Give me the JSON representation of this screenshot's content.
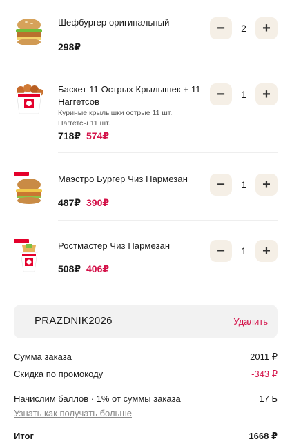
{
  "items": [
    {
      "title": "Шефбургер оригинальный",
      "price": "298₽",
      "qty": "2",
      "image": "chef-burger-image"
    },
    {
      "title": "Баскет 11 Острых Крылышек + 11 Наггетсов",
      "sub": [
        "Куриные крылышки острые 11 шт.",
        "Наггетсы 11 шт."
      ],
      "price_old": "718₽",
      "price_new": "574₽",
      "qty": "1",
      "image": "bucket-image"
    },
    {
      "title": "Маэстро Бургер Чиз Пармезан",
      "price_old": "487₽",
      "price_new": "390₽",
      "qty": "1",
      "image": "maestro-burger-image"
    },
    {
      "title": "Ростмастер Чиз Пармезан",
      "price_old": "508₽",
      "price_new": "406₽",
      "qty": "1",
      "image": "rostmaster-image"
    }
  ],
  "stepper": {
    "minus": "−",
    "plus": "+"
  },
  "promo": {
    "code": "PRAZDNIK2026",
    "remove": "Удалить"
  },
  "summary": {
    "order_sum_label": "Сумма заказа",
    "order_sum_value": "2011 ₽",
    "discount_label": "Скидка по промокоду",
    "discount_value": "-343 ₽",
    "points_label": "Начислим баллов · 1% от суммы заказа",
    "points_value": "17 Б",
    "more_link": "Узнать как получать больше",
    "total_label": "Итог",
    "total_value": "1668 ₽"
  },
  "colors": {
    "accent": "#d4134a",
    "stepper_bg": "#f5efe6",
    "promo_bg": "#f2f2f2",
    "badge": "#e4002b"
  }
}
